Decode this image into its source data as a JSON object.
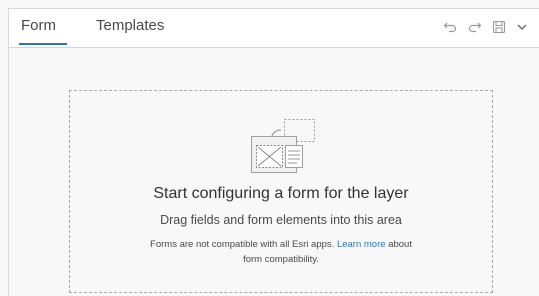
{
  "tabs": [
    {
      "label": "Form",
      "active": true
    },
    {
      "label": "Templates",
      "active": false
    }
  ],
  "toolbar": {
    "undo_icon": "undo-icon",
    "redo_icon": "redo-icon",
    "save_icon": "save-icon",
    "menu_icon": "chevron-down-icon"
  },
  "empty_state": {
    "illustration_icon": "form-layout-illustration-icon",
    "title": "Start configuring a form for the layer",
    "subtitle": "Drag fields and form elements into this area",
    "note_prefix": "Forms are not compatible with all Esri apps.",
    "note_link": "Learn more",
    "note_mid": "about",
    "note_suffix": "form compatibility."
  },
  "colors": {
    "accent": "#2b78b9",
    "text": "#4a4a4a",
    "border": "#a9a9a9"
  }
}
